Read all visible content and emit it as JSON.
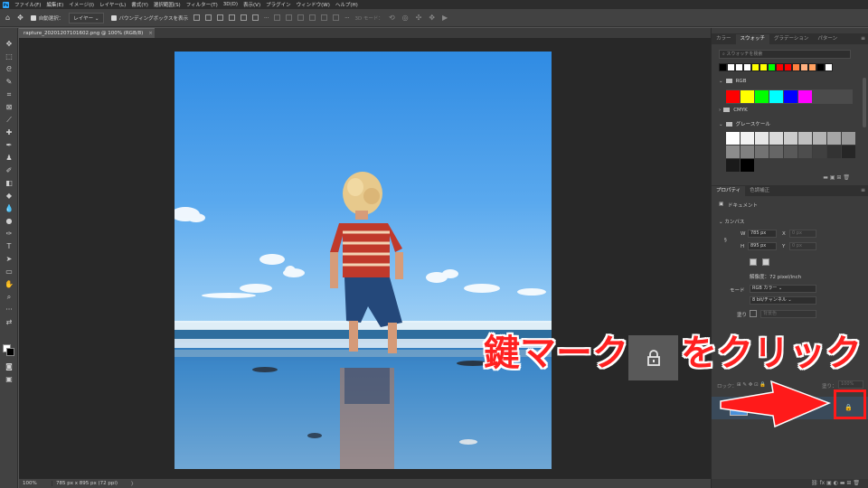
{
  "app": {
    "logo": "Ps"
  },
  "menu": [
    "ファイル(F)",
    "編集(E)",
    "イメージ(I)",
    "レイヤー(L)",
    "書式(Y)",
    "選択範囲(S)",
    "フィルター(T)",
    "3D(D)",
    "表示(V)",
    "プラグイン",
    "ウィンドウ(W)",
    "ヘルプ(H)"
  ],
  "options": {
    "auto_select_label": "自動選択：",
    "auto_select_value": "レイヤー",
    "bounding_box_label": "バウンディングボックスを表示",
    "mode_3d_label": "3D モード："
  },
  "document": {
    "tab_title": "rapture_20201207101602.png @ 100% (RGB/8)",
    "close_glyph": "×"
  },
  "status": {
    "zoom": "100%",
    "doc_size": "785 px x 895 px (72 ppi)",
    "arrow": "〉"
  },
  "swatches_panel": {
    "tabs": [
      "カラー",
      "スウォッチ",
      "グラデーション",
      "パターン"
    ],
    "active_tab": "スウォッチ",
    "search_placeholder": "スウォッチを検索",
    "recent_colors": [
      "#000000",
      "#ffffff",
      "#ffffff",
      "#ffffff",
      "#ffff00",
      "#ffff00",
      "#00ff00",
      "#ff0000",
      "#ff0000",
      "#ff8040",
      "#ffb080",
      "#ffa060",
      "#000000",
      "#ffffff"
    ],
    "groups": {
      "rgb": {
        "name": "RGB",
        "colors": [
          "#ff0000",
          "#ffff00",
          "#00ff00",
          "#00ffff",
          "#0000ff",
          "#ff00ff"
        ]
      },
      "cmyk": {
        "name": "CMYK"
      },
      "gray": {
        "name": "グレースケール",
        "colors": [
          "#ffffff",
          "#f2f2f2",
          "#e6e6e6",
          "#d9d9d9",
          "#cccccc",
          "#bfbfbf",
          "#b3b3b3",
          "#a6a6a6",
          "#999999",
          "#8c8c8c",
          "#808080",
          "#737373",
          "#666666",
          "#595959",
          "#4d4d4d",
          "#404040",
          "#333333",
          "#262626",
          "#1a1a1a",
          "#000000"
        ]
      }
    }
  },
  "properties_panel": {
    "tabs": [
      "プロパティ",
      "色調補正"
    ],
    "active_tab": "プロパティ",
    "doc_label": "ドキュメント",
    "canvas_label": "カンバス",
    "w_label": "W",
    "w_value": "785 px",
    "h_label": "H",
    "h_value": "895 px",
    "x_label": "X",
    "x_value": "0 px",
    "y_label": "Y",
    "y_value": "0 px",
    "resolution": "解像度：72 pixel/inch",
    "mode_label": "モード",
    "mode_value": "RGB カラー",
    "depth_value": "8 bit/チャンネル",
    "fill_label": "塗り",
    "fill_value": "背景色"
  },
  "layers_panel": {
    "lock_label": "ロック：",
    "fill_label": "塗り：",
    "fill_value": "100%"
  },
  "annotation": {
    "text_before": "鍵マーク",
    "text_after": "をクリック",
    "color": "#ff2121"
  }
}
